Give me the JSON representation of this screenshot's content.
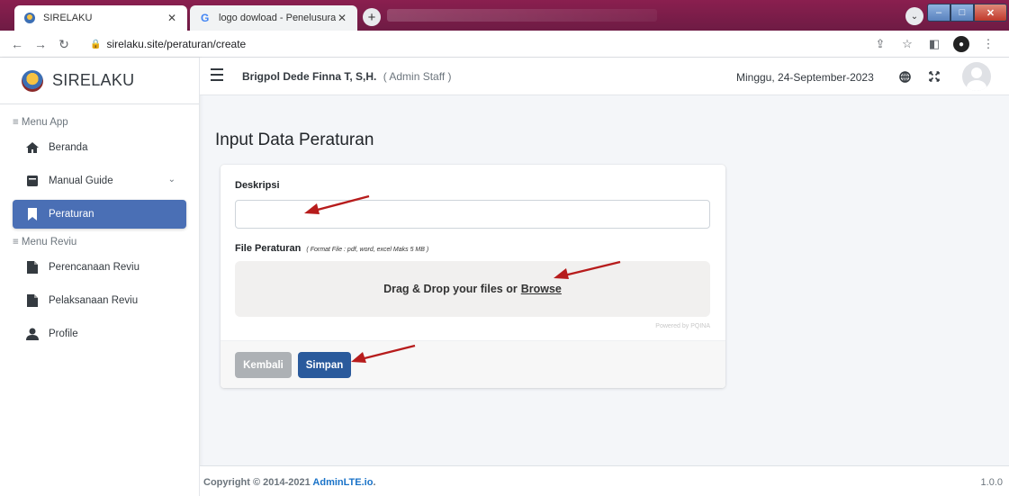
{
  "browser": {
    "tabs": [
      {
        "title": "SIRELAKU",
        "favicon": "shield-logo-icon",
        "active": true
      },
      {
        "title": "logo dowload - Penelusuran Goo",
        "favicon": "google-icon",
        "active": false
      }
    ],
    "url": "sirelaku.site/peraturan/create"
  },
  "sidebar": {
    "brand": "SIRELAKU",
    "header_app": "≡ Menu App",
    "header_reviu": "≡ Menu Reviu",
    "items": [
      {
        "label": "Beranda",
        "icon": "home-icon"
      },
      {
        "label": "Manual Guide",
        "icon": "book-icon"
      },
      {
        "label": "Peraturan",
        "icon": "bookmark-icon"
      },
      {
        "label": "Perencanaan Reviu",
        "icon": "file-icon"
      },
      {
        "label": "Pelaksanaan Reviu",
        "icon": "file-icon"
      },
      {
        "label": "Profile",
        "icon": "user-icon"
      }
    ]
  },
  "topbar": {
    "user_name": "Brigpol Dede Finna T, S,H.",
    "user_role": "( Admin Staff )",
    "date": "Minggu, 24-September-2023"
  },
  "page": {
    "title": "Input Data Peraturan"
  },
  "form": {
    "deskripsi_label": "Deskripsi",
    "deskripsi_value": "",
    "file_label": "File Peraturan",
    "file_hint": "( Format File : pdf, word, excel Maks 5 MB )",
    "drop_text": "Drag & Drop your files or",
    "browse_text": "Browse",
    "powered_by": "Powered by PQINA",
    "back_label": "Kembali",
    "save_label": "Simpan"
  },
  "colors": {
    "active_nav": "#4a6fb5",
    "save_button": "#2a5a9c",
    "back_button": "#adb1b5",
    "annotation_arrow": "#b71c1c"
  },
  "footer": {
    "copyright_prefix": "Copyright © 2014-2021",
    "copyright_link": "AdminLTE.io",
    "copyright_suffix": ".",
    "version": "1.0.0"
  }
}
